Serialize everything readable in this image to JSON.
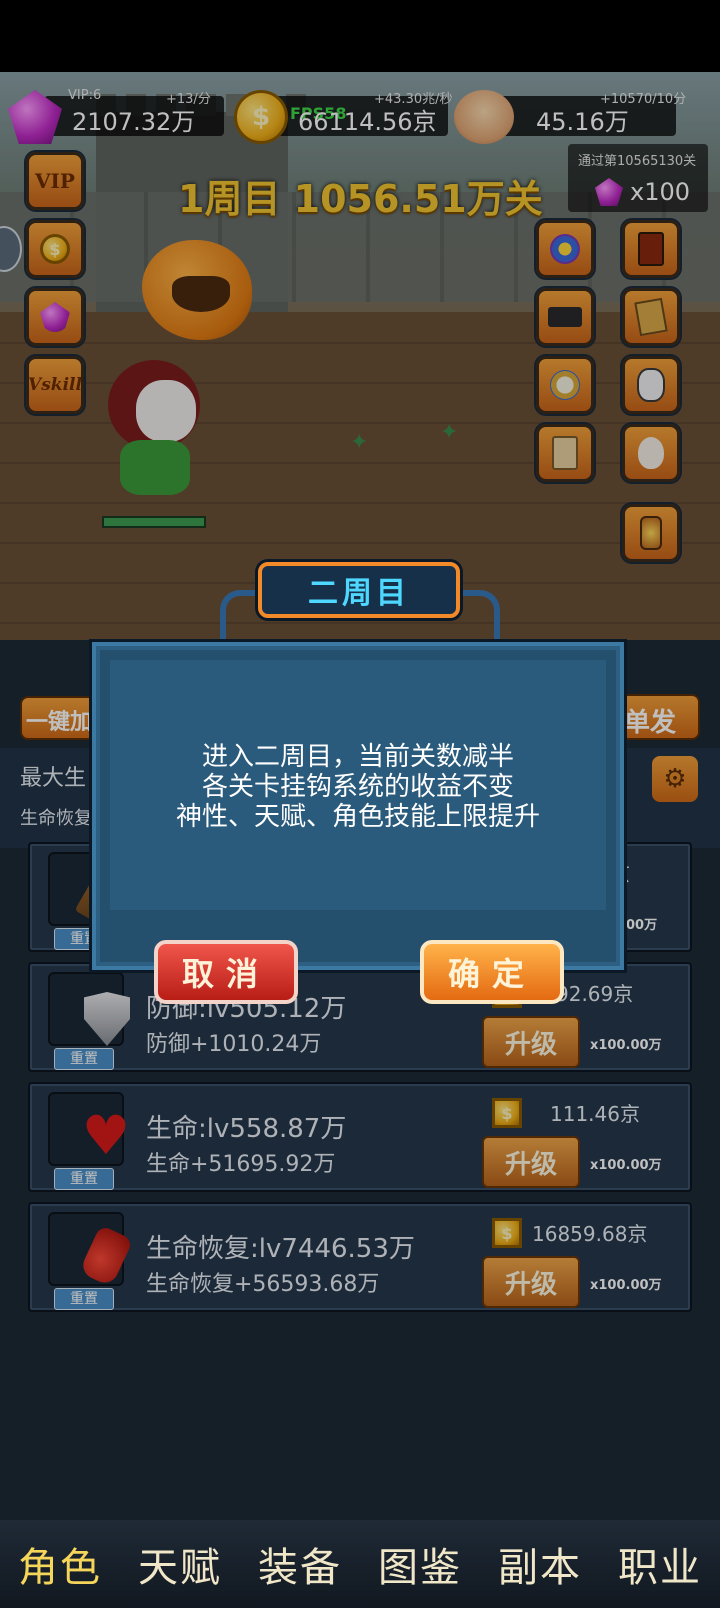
{
  "resources": {
    "gems": {
      "top_label": "VIP:6",
      "rate": "+13/分",
      "amount": "2107.32万"
    },
    "gold": {
      "fps": "FPS58",
      "rate": "+43.30兆/秒",
      "amount": "66114.56京"
    },
    "bones": {
      "rate": "+10570/10分",
      "amount": "45.16万"
    }
  },
  "stage": {
    "title": "1周目 1056.51万关"
  },
  "pass_reward": {
    "text": "通过第10565130关",
    "count": "x100"
  },
  "left_buttons": {
    "vip": "VIP",
    "skill": "Vskill"
  },
  "background": {
    "left_button": "一键加",
    "right_button": "单发",
    "stat_a": "最大生",
    "stat_b": "生命恢复"
  },
  "upgrades": [
    {
      "name": "axe",
      "line1": "",
      "line2": "",
      "cost": "京",
      "mult": "0.00万",
      "reset": "重置"
    },
    {
      "name": "defense",
      "line1": "防御:lv505.12万",
      "line2": "防御+1010.24万",
      "cost": "92.69京",
      "upgrade": "升级",
      "mult": "x100.00万",
      "reset": "重置"
    },
    {
      "name": "life",
      "line1": "生命:lv558.87万",
      "line2": "生命+51695.92万",
      "cost": "111.46京",
      "upgrade": "升级",
      "mult": "x100.00万",
      "reset": "重置"
    },
    {
      "name": "regen",
      "line1": "生命恢复:lv7446.53万",
      "line2": "生命恢复+56593.68万",
      "cost": "16859.68京",
      "upgrade": "升级",
      "mult": "x100.00万",
      "reset": "重置"
    }
  ],
  "dialog": {
    "title": "二周目",
    "line1": "进入二周目，当前关数减半",
    "line2": "各关卡挂钩系统的收益不变",
    "line3": "神性、天赋、角色技能上限提升",
    "cancel": "取消",
    "confirm": "确定"
  },
  "nav": [
    "角色",
    "天赋",
    "装备",
    "图鉴",
    "副本",
    "职业"
  ]
}
